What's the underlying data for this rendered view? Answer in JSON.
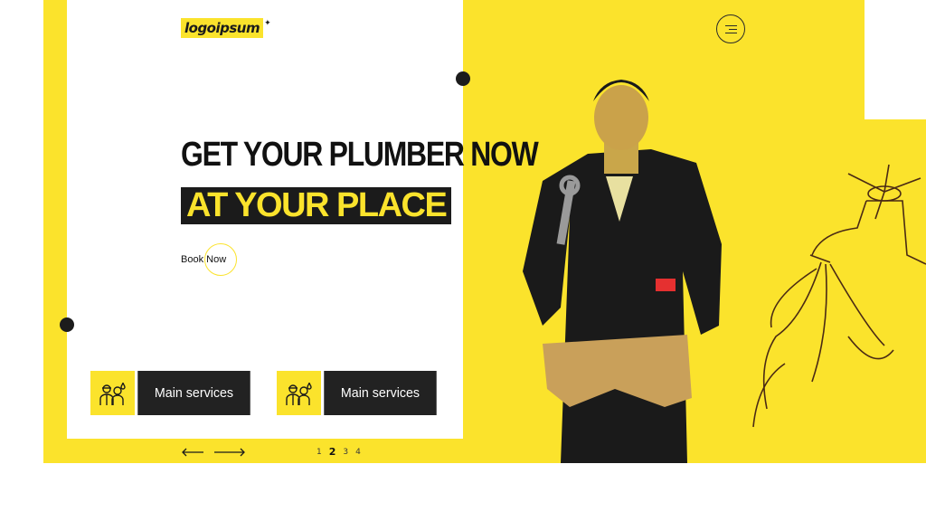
{
  "brand": {
    "logo_text": "logoipsum",
    "accent_color": "#fbe32c",
    "dark_color": "#1b1b1b"
  },
  "header": {
    "menu_icon": "hamburger-menu-icon"
  },
  "hero": {
    "headline_line1": "GET YOUR PLUMBER NOW",
    "headline_line2": "AT YOUR PLACE",
    "cta_label": "Book Now"
  },
  "services": [
    {
      "label": "Main services",
      "icon": "plumbers-icon"
    },
    {
      "label": "Main services",
      "icon": "plumbers-icon"
    }
  ],
  "slider": {
    "prev_icon": "arrow-left-icon",
    "next_icon": "arrow-right-icon",
    "pages": [
      "1",
      "2",
      "3",
      "4"
    ],
    "active_page": "2"
  },
  "illustrations": {
    "person": "plumber-photo",
    "faucet": "faucet-sketch"
  }
}
